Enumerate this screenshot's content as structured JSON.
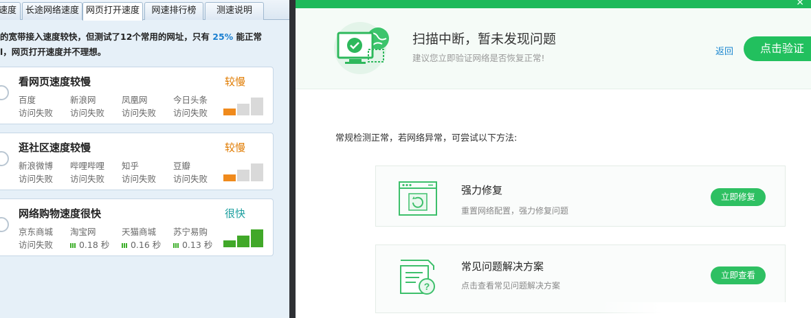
{
  "left_panel": {
    "tabs": [
      {
        "label": "速度"
      },
      {
        "label": "长途网络速度"
      },
      {
        "label": "网页打开速度"
      },
      {
        "label": "网速排行榜"
      },
      {
        "label": "测速说明"
      }
    ],
    "summary": {
      "line1_prefix": "的宽带接入速度较快，但测试了12个常用的网址，只有",
      "percent": "25%",
      "line1_suffix": "能正常",
      "line2": "l，网页打开速度并不理想。"
    },
    "cards": [
      {
        "title": "看网页速度较慢",
        "status": "较慢",
        "status_color": "#e07b00",
        "sites": [
          {
            "name": "百度",
            "result": "访问失败"
          },
          {
            "name": "新浪网",
            "result": "访问失败"
          },
          {
            "name": "凤凰网",
            "result": "访问失败"
          },
          {
            "name": "今日头条",
            "result": "访问失败"
          }
        ],
        "signal_level": 1
      },
      {
        "title": "逛社区速度较慢",
        "status": "较慢",
        "status_color": "#e07b00",
        "sites": [
          {
            "name": "新浪微博",
            "result": "访问失败"
          },
          {
            "name": "哔哩哔哩",
            "result": "访问失败"
          },
          {
            "name": "知乎",
            "result": "访问失败"
          },
          {
            "name": "豆瓣",
            "result": "访问失败"
          }
        ],
        "signal_level": 1
      },
      {
        "title": "网络购物速度很快",
        "status": "很快",
        "status_color": "#1a9e9e",
        "sites": [
          {
            "name": "京东商城",
            "result": "访问失败"
          },
          {
            "name": "淘宝网",
            "result": "0.18 秒"
          },
          {
            "name": "天猫商城",
            "result": "0.16 秒"
          },
          {
            "name": "苏宁易购",
            "result": "0.13 秒"
          }
        ],
        "signal_level": 3
      }
    ]
  },
  "right_panel": {
    "header": {
      "title": "扫描中断，暂未发现问题",
      "subtitle": "建议您立即验证网络是否恢复正常!",
      "back_label": "返回",
      "verify_label": "点击验证"
    },
    "intro": "常规检测正常，若网络异常，可尝试以下方法:",
    "fixes": [
      {
        "icon": "window-repair-icon",
        "name": "强力修复",
        "desc": "重置网络配置，强力修复问题",
        "button": "立即修复"
      },
      {
        "icon": "faq-document-icon",
        "name": "常见问题解决方案",
        "desc": "点击查看常见问题解决方案",
        "button": "立即查看"
      }
    ],
    "colors": {
      "accent": "#22c05e",
      "link": "#1a86d0"
    }
  }
}
